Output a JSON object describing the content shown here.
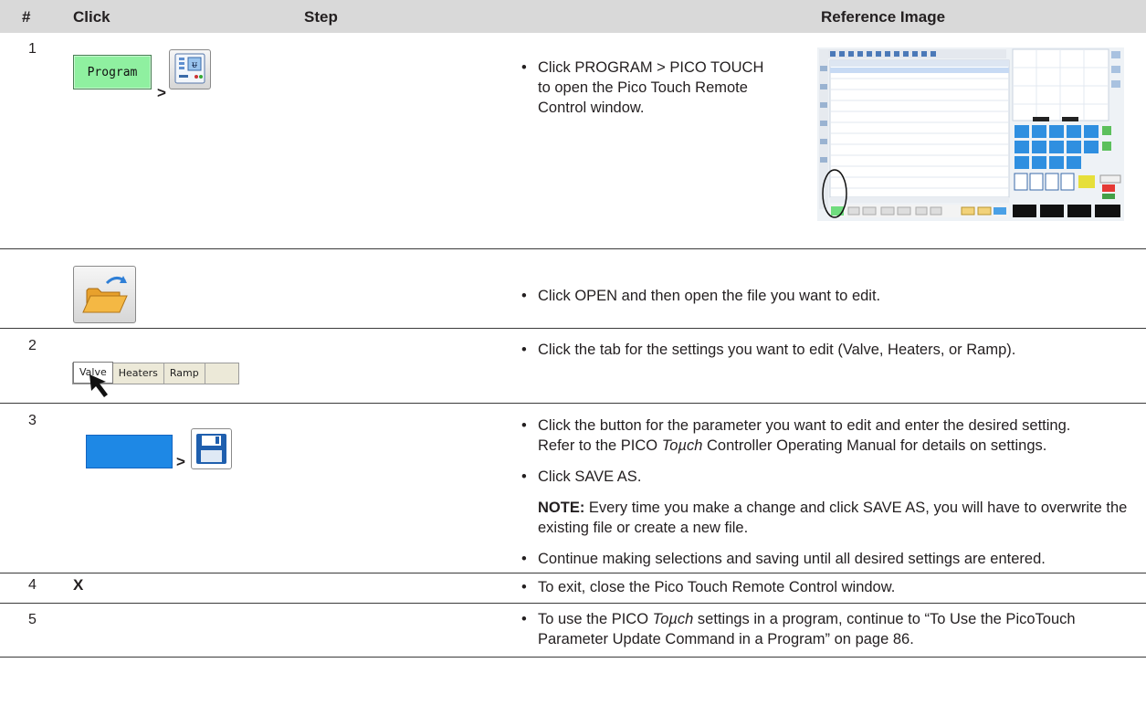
{
  "header": {
    "col_num": "#",
    "col_click": "Click",
    "col_step": "Step",
    "col_ref": "Reference Image"
  },
  "rows": [
    {
      "num": "1",
      "program_label": "Program",
      "gt": ">",
      "step": "Click PROGRAM > PICO TOUCH to open the Pico Touch Remote Control window."
    },
    {
      "num": "",
      "step": "Click OPEN and then open the file you want to edit."
    },
    {
      "num": "2",
      "tabs": [
        "Valve",
        "Heaters",
        "Ramp"
      ],
      "step": "Click the tab for the settings you want to edit (Valve, Heaters, or Ramp)."
    },
    {
      "num": "3",
      "gt": ">",
      "step_a_1": "Click the button for the parameter you want to edit and enter the desired setting.",
      "step_a_2_pre": "Refer to the PICO ",
      "step_a_2_ital": "Toµch",
      "step_a_2_post": " Controller Operating Manual for details on settings.",
      "step_b": "Click SAVE AS.",
      "note_label": "NOTE:",
      "note_text": " Every time you make a change and click SAVE AS, you will have to overwrite the existing file or create a new file.",
      "step_c": "Continue making selections and saving until all desired settings are entered."
    },
    {
      "num": "4",
      "click": "X",
      "step": "To exit, close the Pico Touch Remote Control window."
    },
    {
      "num": "5",
      "step_1_pre": "To use the PICO ",
      "step_1_ital": "Toµch",
      "step_1_post": " settings in a program, continue to “To Use the PicoTouch",
      "step_2": "Parameter Update Command in a Program” on page 86."
    }
  ],
  "bullet": "•",
  "colors": {
    "header_bg": "#d9d9d9",
    "rule": "#3a3a3a",
    "blue": "#1e88e5",
    "program_green": "#8ff0a0"
  },
  "icons": [
    "pico-touch-icon",
    "open-folder-icon",
    "cursor-arrow-icon",
    "save-disk-icon"
  ]
}
